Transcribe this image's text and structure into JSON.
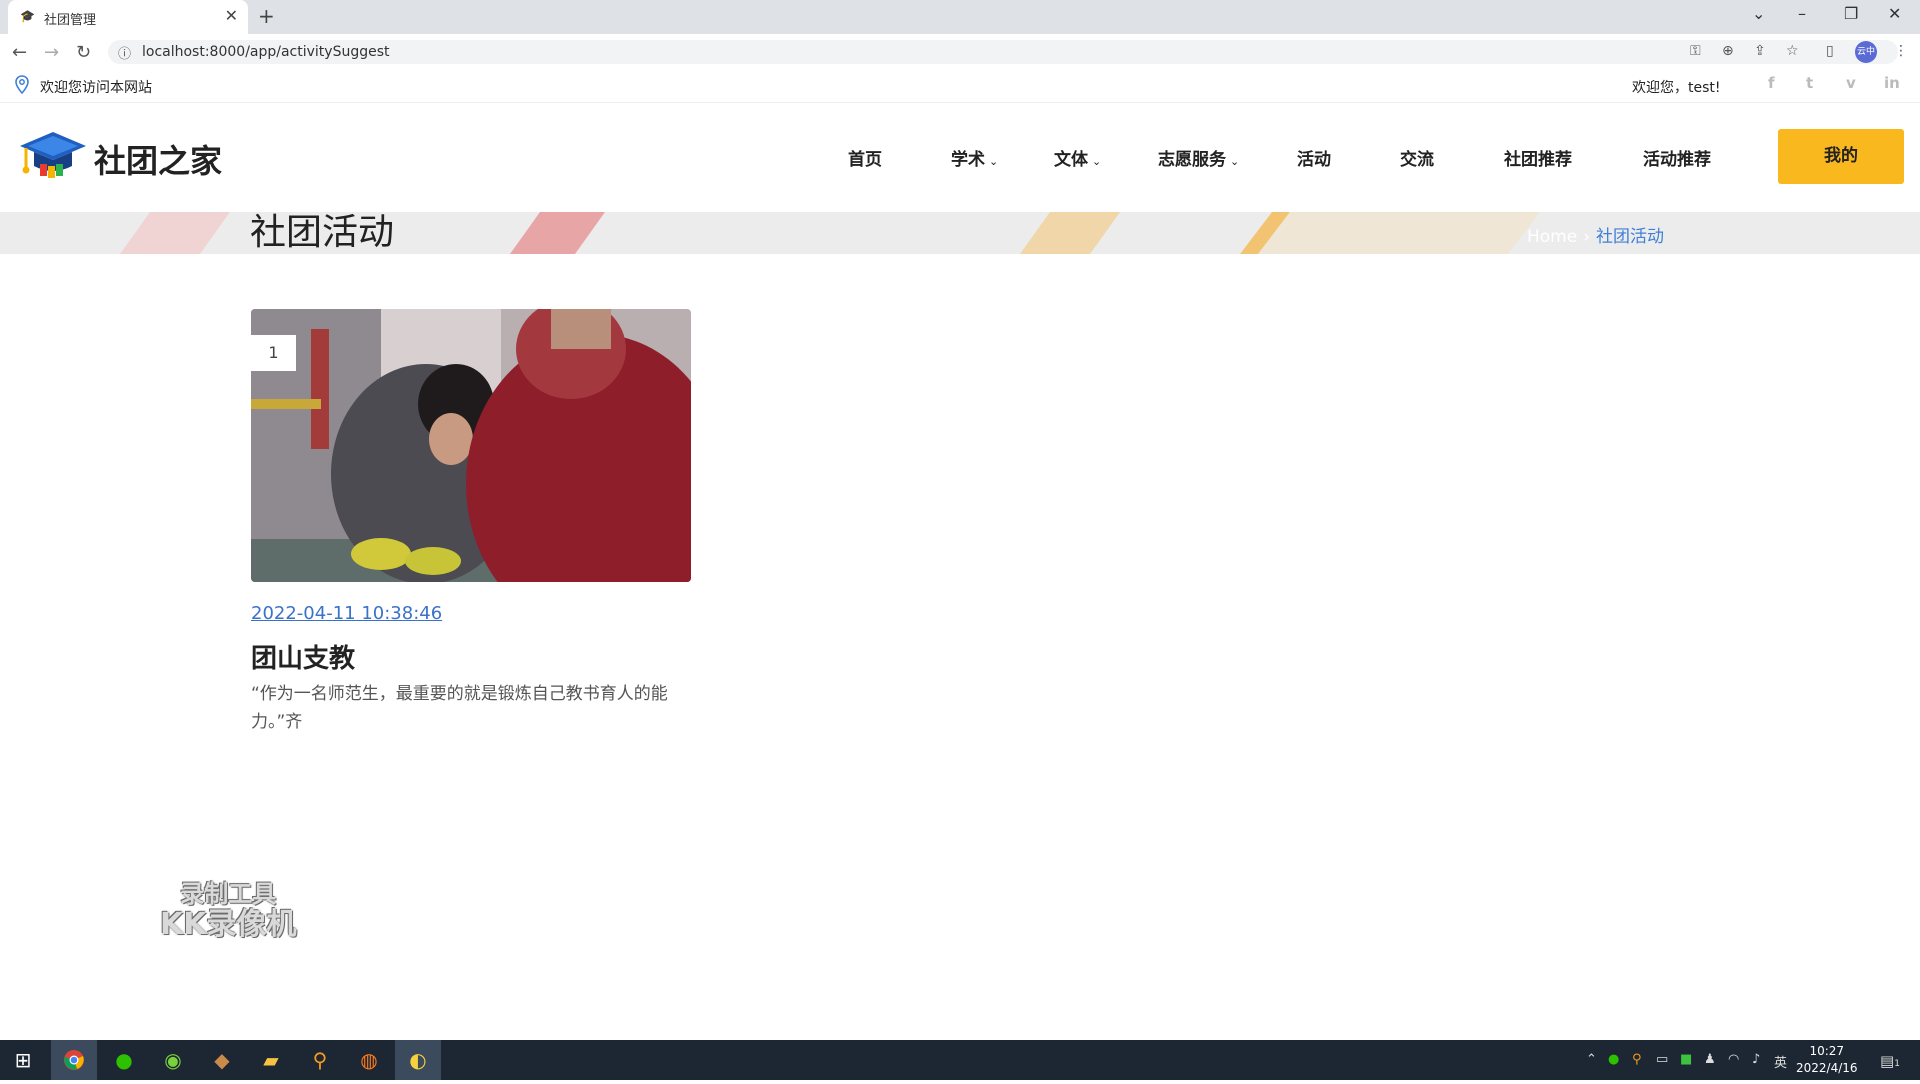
{
  "browser": {
    "tab_title": "社团管理",
    "url": "localhost:8000/app/activitySuggest",
    "profile": "云中"
  },
  "topbar": {
    "welcome": "欢迎您访问本网站",
    "user": "欢迎您，test!",
    "social": [
      "f",
      "t",
      "v",
      "in"
    ]
  },
  "header": {
    "logo_text": "社团之家",
    "nav": [
      {
        "label": "首页",
        "dropdown": false
      },
      {
        "label": "学术",
        "dropdown": true
      },
      {
        "label": "文体",
        "dropdown": true
      },
      {
        "label": "志愿服务",
        "dropdown": true
      },
      {
        "label": "活动",
        "dropdown": false
      },
      {
        "label": "交流",
        "dropdown": false
      },
      {
        "label": "社团推荐",
        "dropdown": false
      },
      {
        "label": "活动推荐",
        "dropdown": false
      }
    ],
    "mine_button": "我的",
    "accent": "#f8b81e"
  },
  "banner": {
    "title": "社团活动",
    "breadcrumb_home": "Home",
    "breadcrumb_current": "社团活动"
  },
  "card": {
    "badge": "1",
    "date": "2022-04-11 10:38:46",
    "title": "团山支教",
    "desc": "“作为一名师范生，最重要的就是锻炼自己教书育人的能力。”齐"
  },
  "watermark": {
    "line1": "录制工具",
    "line2": "KK录像机"
  },
  "taskbar": {
    "time": "10:27",
    "date": "2022/4/16",
    "ime": "英",
    "notifications": "1"
  }
}
